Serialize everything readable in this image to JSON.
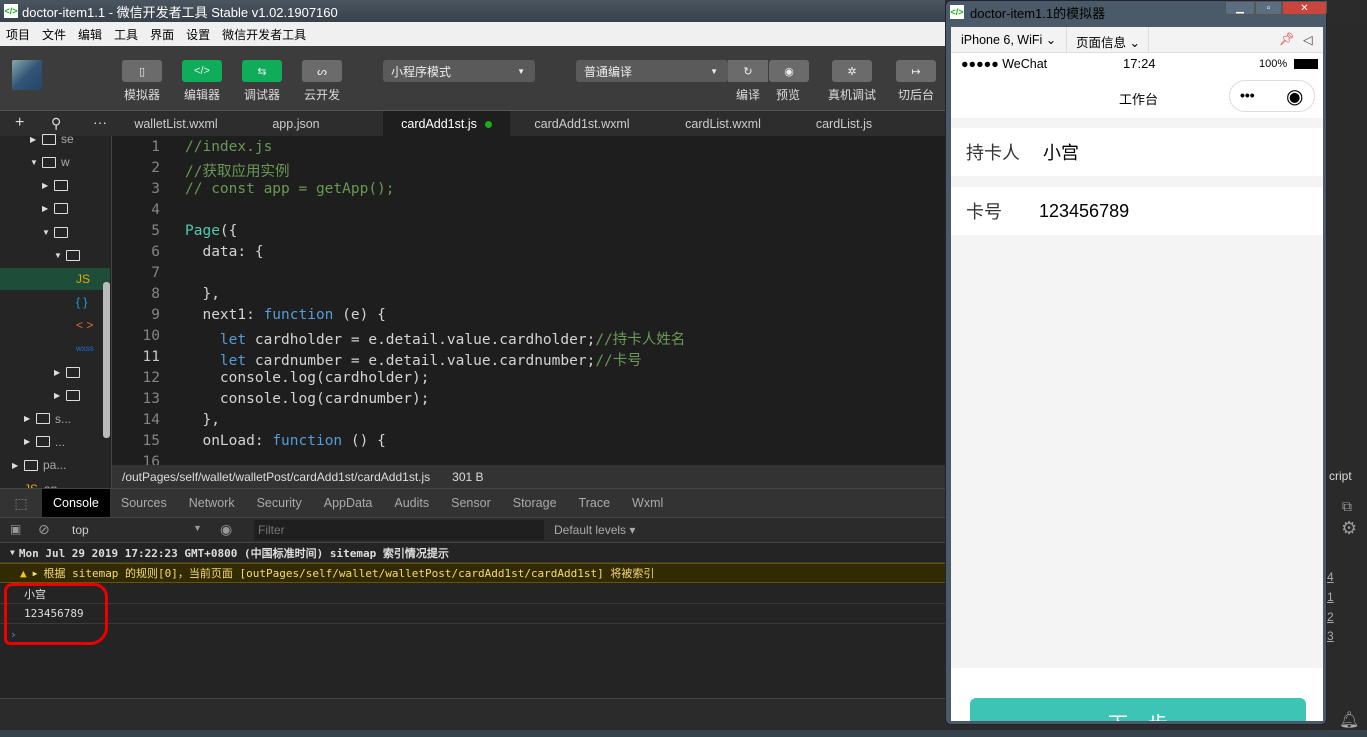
{
  "window": {
    "title": "doctor-item1.1 - 微信开发者工具 Stable v1.02.1907160",
    "logo": "</>"
  },
  "menu": [
    "项目",
    "文件",
    "编辑",
    "工具",
    "界面",
    "设置",
    "微信开发者工具"
  ],
  "toolbar": {
    "simulator": "模拟器",
    "editor": "编辑器",
    "debugger": "调试器",
    "cloud": "云开发",
    "mode": "小程序模式",
    "compile_mode": "普通编译",
    "compile": "编译",
    "preview": "预览",
    "remote_debug": "真机调试",
    "background": "切后台"
  },
  "tabs": [
    {
      "label": "walletList.wxml"
    },
    {
      "label": "app.json"
    },
    {
      "label": "cardAdd1st.js",
      "active": true,
      "modified": true
    },
    {
      "label": "cardAdd1st.wxml"
    },
    {
      "label": "cardList.wxml"
    },
    {
      "label": "cardList.js"
    }
  ],
  "sidebar": {
    "items": [
      "se",
      "w",
      "",
      "",
      "",
      "",
      "JS",
      "{ }",
      "< >",
      "wxss",
      "",
      "",
      "s...",
      "...",
      "pa...",
      "ap..."
    ]
  },
  "code": {
    "lines": [
      [
        [
          "//index.js",
          "com"
        ]
      ],
      [
        [
          "//获取应用实例",
          "com"
        ]
      ],
      [
        [
          "// const app = getApp();",
          "com"
        ]
      ],
      [],
      [
        [
          "Page",
          "cls"
        ],
        [
          "({",
          ""
        ]
      ],
      [
        [
          "  data: {",
          ""
        ]
      ],
      [],
      [
        [
          "  },",
          ""
        ]
      ],
      [
        [
          "  next1: ",
          ""
        ],
        [
          "function",
          "kw"
        ],
        [
          " (e) {",
          ""
        ]
      ],
      [
        [
          "    ",
          ""
        ],
        [
          "let",
          "kw"
        ],
        [
          " cardholder = e.detail.value.cardholder;",
          ""
        ],
        [
          "//持卡人姓名",
          "com"
        ]
      ],
      [
        [
          "    ",
          ""
        ],
        [
          "let",
          "kw"
        ],
        [
          " cardnumber = e.detail.value.cardnumber;",
          ""
        ],
        [
          "//卡号",
          "com"
        ]
      ],
      [
        [
          "    console.log(cardholder);",
          ""
        ]
      ],
      [
        [
          "    console.log(cardnumber);",
          ""
        ]
      ],
      [
        [
          "  },",
          ""
        ]
      ],
      [
        [
          "  onLoad: ",
          ""
        ],
        [
          "function",
          "kw"
        ],
        [
          " () {",
          ""
        ]
      ],
      [
        [
          "",
          ""
        ]
      ]
    ],
    "current_line": 11
  },
  "status": {
    "path": "/outPages/self/wallet/walletPost/cardAdd1st/cardAdd1st.js",
    "size": "301 B",
    "right": "cript"
  },
  "devtools": {
    "tabs": [
      "Console",
      "Sources",
      "Network",
      "Security",
      "AppData",
      "Audits",
      "Sensor",
      "Storage",
      "Trace",
      "Wxml"
    ],
    "context": "top",
    "filter_placeholder": "Filter",
    "levels": "Default levels"
  },
  "console": {
    "group": "Mon Jul 29 2019 17:22:23 GMT+0800 (中国标准时间) sitemap 索引情况提示",
    "warning": "根据 sitemap 的规则[0]，当前页面 [outPages/self/wallet/walletPost/cardAdd1st/cardAdd1st] 将被索引",
    "logs": [
      "小宫",
      "123456789"
    ],
    "line_refs": [
      "4",
      "1",
      "2",
      "3"
    ]
  },
  "simulator": {
    "title": "doctor-item1.1的模拟器",
    "device": "iPhone 6, WiFi",
    "page_info": "页面信息",
    "statusbar": {
      "carrier": "●●●●● WeChat",
      "time": "17:24",
      "battery": "100%"
    },
    "nav_title": "工作台",
    "fields": [
      {
        "label": "持卡人",
        "value": "小宫"
      },
      {
        "label": "卡号",
        "value": "123456789"
      }
    ],
    "button": "下一步",
    "accent": "#3ec4b5"
  }
}
